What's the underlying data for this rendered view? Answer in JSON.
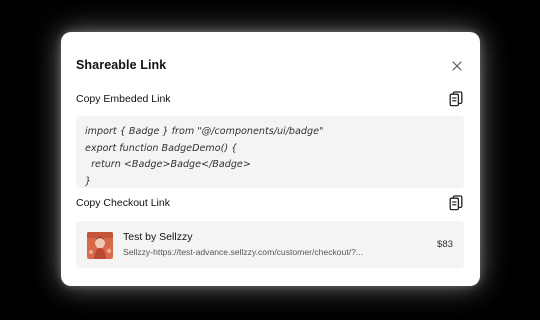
{
  "modal": {
    "title": "Shareable Link",
    "close_icon": "close-icon"
  },
  "embed": {
    "label": "Copy Embeded Link",
    "copy_icon": "clipboard-copy-icon",
    "code_lines": [
      "import { Badge } from \"@/components/ui/badge\"",
      "export function BadgeDemo() {",
      "  return <Badge>Badge</Badge>",
      "}"
    ]
  },
  "checkout": {
    "label": "Copy Checkout Link",
    "copy_icon": "clipboard-copy-icon",
    "product_name": "Test by Sellzzy",
    "product_url": "Sellzzy-https://test-advance.sellzzy.com/customer/checkout/?...",
    "price": "$83"
  },
  "colors": {
    "backdrop": "#000000",
    "modal_bg": "#ffffff",
    "panel_bg": "#f4f4f5",
    "text_primary": "#111111"
  }
}
